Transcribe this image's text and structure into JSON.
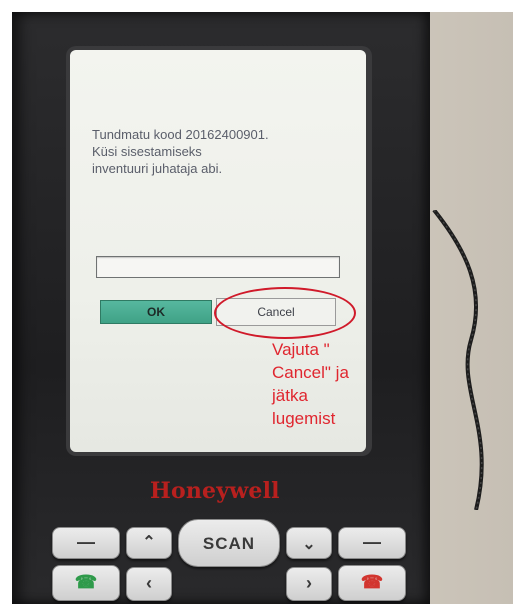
{
  "dialog": {
    "message_lines": [
      "Tundmatu kood 20162400901.",
      "Küsi sisestamiseks",
      "inventuuri juhataja abi."
    ],
    "input_value": "",
    "ok_label": "OK",
    "cancel_label": "Cancel"
  },
  "annotation": {
    "lines": [
      "Vajuta \"",
      "Cancel\" ja",
      "jätka",
      "lugemist"
    ],
    "color": "#e0262f"
  },
  "device": {
    "brand": "Honeywell",
    "scan_label": "SCAN"
  },
  "colors": {
    "ok_button": "#4aaa8f",
    "brand": "#b8201e",
    "call_green": "#2e9a4a",
    "end_red": "#d2352f"
  },
  "icons": {
    "call_key": "phone-call-icon",
    "end_key": "phone-end-icon",
    "up": "chevron-up-icon",
    "down": "chevron-down-icon",
    "left": "chevron-left-icon",
    "right": "chevron-right-icon",
    "soft_left": "dash-icon",
    "soft_right": "dash-icon"
  }
}
